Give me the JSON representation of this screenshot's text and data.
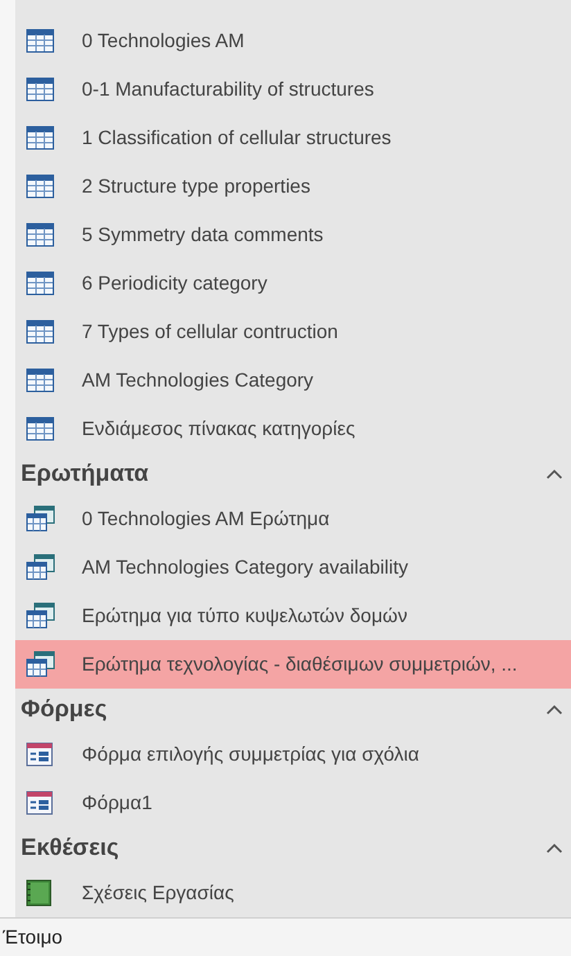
{
  "navigation_pane": {
    "groups": [
      {
        "items": [
          {
            "label": "0 Technologies AM",
            "kind": "table",
            "selected": false
          },
          {
            "label": "0-1 Manufacturability of structures",
            "kind": "table",
            "selected": false
          },
          {
            "label": "1 Classification of cellular structures",
            "kind": "table",
            "selected": false
          },
          {
            "label": "2 Structure type properties",
            "kind": "table",
            "selected": false
          },
          {
            "label": "5 Symmetry data comments",
            "kind": "table",
            "selected": false
          },
          {
            "label": "6 Periodicity category",
            "kind": "table",
            "selected": false
          },
          {
            "label": "7 Types of cellular contruction",
            "kind": "table",
            "selected": false
          },
          {
            "label": "AM Technologies Category",
            "kind": "table",
            "selected": false
          },
          {
            "label": "Ενδιάμεσος πίνακας κατηγορίες",
            "kind": "table",
            "selected": false
          }
        ]
      },
      {
        "title": "Ερωτήματα",
        "expanded": true,
        "items": [
          {
            "label": "0 Technologies AM Ερώτημα",
            "kind": "query",
            "selected": false
          },
          {
            "label": "AM Technologies Category availability",
            "kind": "query",
            "selected": false
          },
          {
            "label": "Ερώτημα για τύπο κυψελωτών δομών",
            "kind": "query",
            "selected": false
          },
          {
            "label": "Ερώτημα τεχνολογίας - διαθέσιμων συμμετριών, ...",
            "kind": "query",
            "selected": true
          }
        ]
      },
      {
        "title": "Φόρμες",
        "expanded": true,
        "items": [
          {
            "label": "Φόρμα επιλογής συμμετρίας για σχόλια",
            "kind": "form",
            "selected": false
          },
          {
            "label": "Φόρμα1",
            "kind": "form",
            "selected": false
          }
        ]
      },
      {
        "title": "Εκθέσεις",
        "expanded": true,
        "items": [
          {
            "label": "Σχέσεις Εργασίας",
            "kind": "report",
            "selected": false
          }
        ]
      }
    ]
  },
  "status_bar": {
    "text": "Έτοιμο"
  }
}
